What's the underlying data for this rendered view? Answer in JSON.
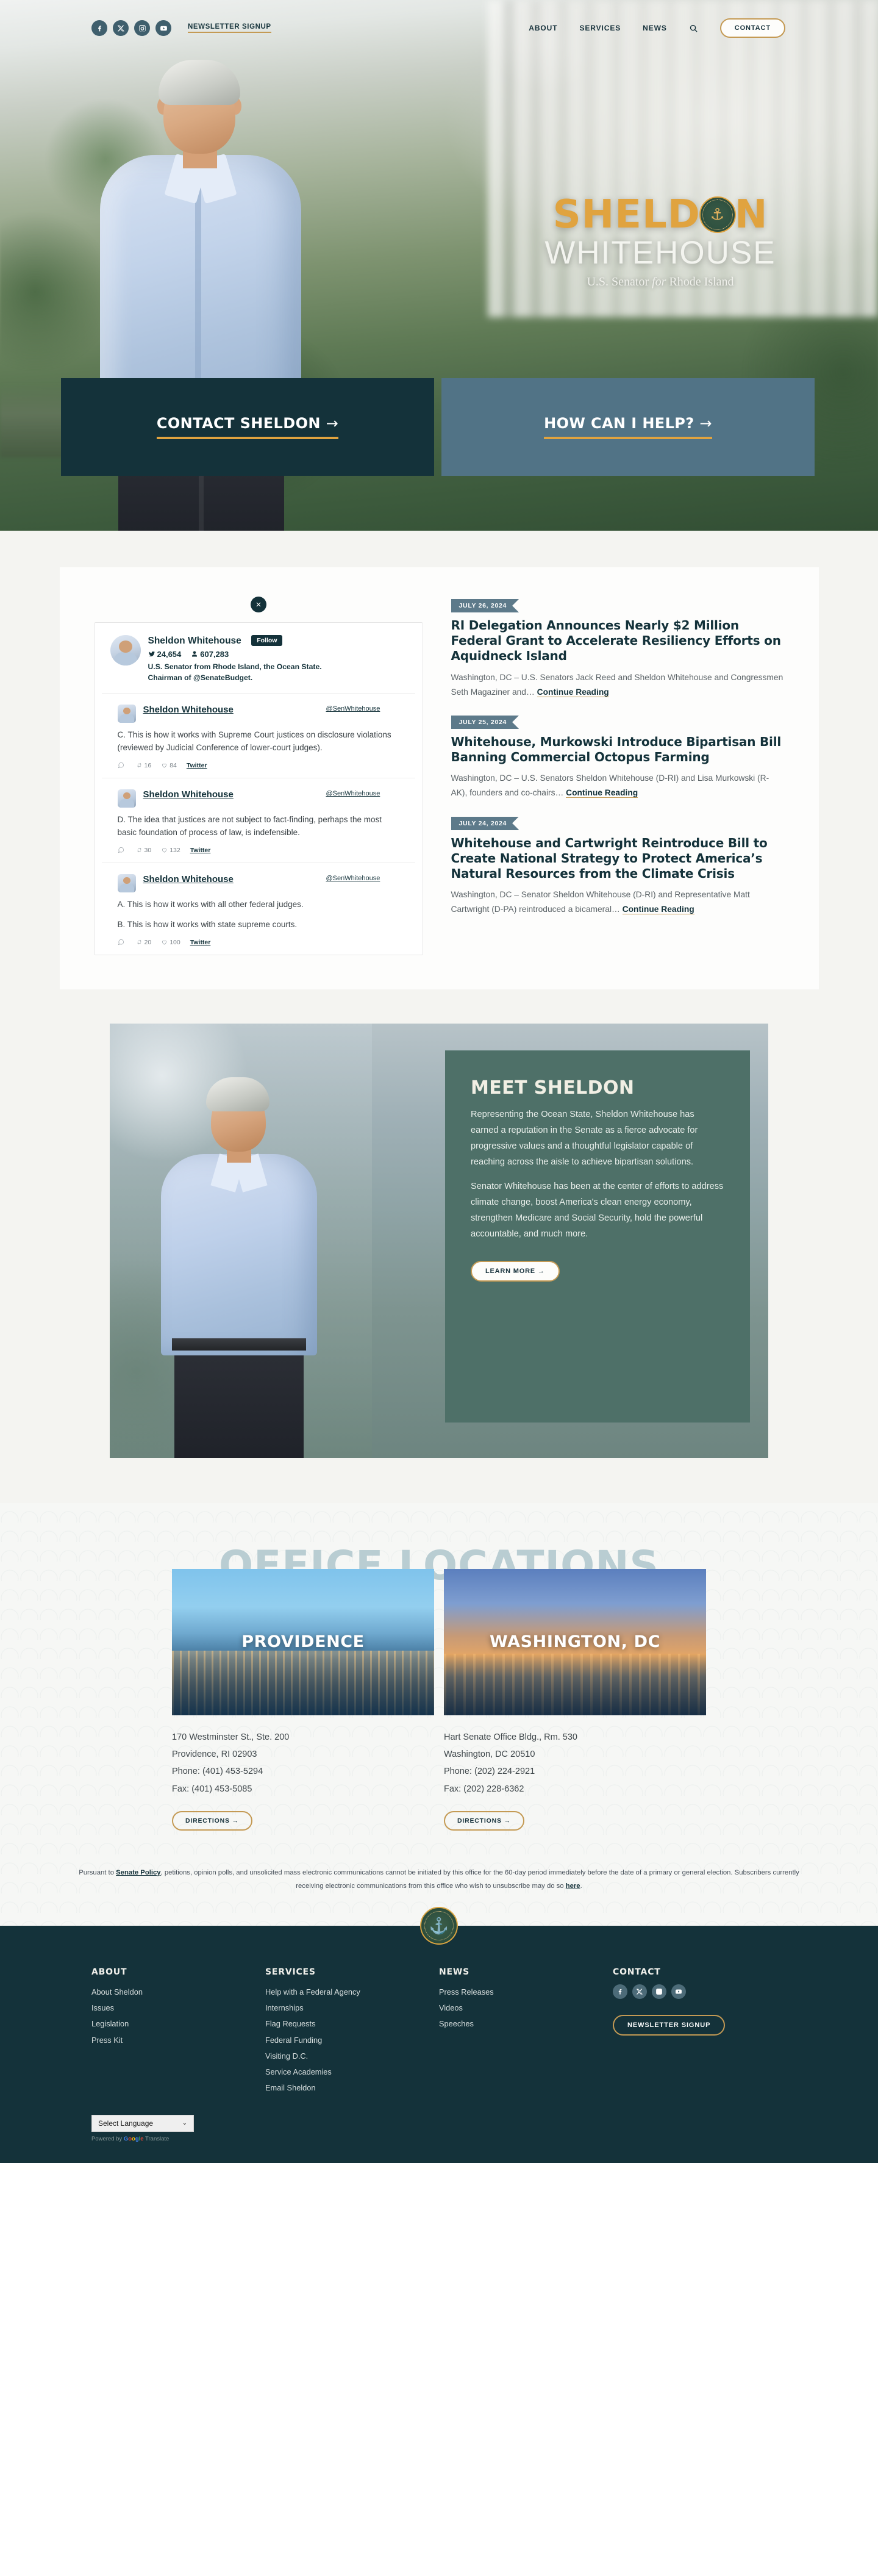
{
  "header": {
    "social": [
      {
        "name": "facebook",
        "glyph": "f"
      },
      {
        "name": "x-twitter",
        "glyph": "X"
      },
      {
        "name": "instagram",
        "glyph": "o"
      },
      {
        "name": "youtube",
        "glyph": "y"
      }
    ],
    "newsletter_label": "NEWSLETTER SIGNUP",
    "nav": [
      {
        "label": "ABOUT"
      },
      {
        "label": "SERVICES"
      },
      {
        "label": "NEWS"
      }
    ],
    "search_label": "Search",
    "contact_label": "CONTACT"
  },
  "hero": {
    "logo_first": "SHELD",
    "logo_last": "N",
    "logo_second_line": "WHITEHOUSE",
    "tagline_pre": "U.S. Senator ",
    "tagline_em": "for",
    "tagline_post": " Rhode Island",
    "cta_primary": "CONTACT SHELDON",
    "cta_primary_arrow": "→",
    "cta_secondary": "HOW CAN I HELP?",
    "cta_secondary_arrow": "→"
  },
  "twitter": {
    "close_label": "Close",
    "account_name": "Sheldon Whitehouse",
    "follow_label": "Follow",
    "tweet_count": "24,654",
    "follower_count": "607,283",
    "bio": "U.S. Senator from Rhode Island, the Ocean State. Chairman of @SenateBudget.",
    "tweets": [
      {
        "user": "Sheldon Whitehouse",
        "handle": "@SenWhitehouse",
        "lines": [
          "C.  This is how it works with Supreme Court justices on disclosure violations (reviewed by Judicial Conference of lower-court judges)."
        ],
        "replies": "",
        "retweets": "16",
        "likes": "84",
        "source": "Twitter"
      },
      {
        "user": "Sheldon Whitehouse",
        "handle": "@SenWhitehouse",
        "lines": [
          "D.  The idea that justices are not subject to fact-finding, perhaps the most basic foundation of process of law, is indefensible."
        ],
        "replies": "",
        "retweets": "30",
        "likes": "132",
        "source": "Twitter"
      },
      {
        "user": "Sheldon Whitehouse",
        "handle": "@SenWhitehouse",
        "lines": [
          "A.  This is how it works with all other federal judges.",
          "B.  This is how it works with state supreme courts."
        ],
        "replies": "",
        "retweets": "20",
        "likes": "100",
        "source": "Twitter"
      }
    ]
  },
  "news": {
    "continue_label": "Continue Reading",
    "items": [
      {
        "date": "JULY 26, 2024",
        "title": "RI Delegation Announces Nearly $2 Million Federal Grant to Accelerate Resiliency Efforts on Aquidneck Island",
        "excerpt": "Washington, DC – U.S. Senators Jack Reed and Sheldon Whitehouse and Congressmen Seth Magaziner and…"
      },
      {
        "date": "JULY 25, 2024",
        "title": "Whitehouse, Murkowski Introduce Bipartisan Bill Banning Commercial Octopus Farming",
        "excerpt": "Washington, DC – U.S. Senators Sheldon Whitehouse (D-RI) and Lisa Murkowski (R-AK), founders and co-chairs…"
      },
      {
        "date": "JULY 24, 2024",
        "title": "Whitehouse and Cartwright Reintroduce Bill to Create National Strategy to Protect America’s Natural Resources from the Climate Crisis",
        "excerpt": "Washington, DC – Senator Sheldon Whitehouse (D-RI) and Representative Matt Cartwright (D-PA) reintroduced a bicameral…"
      }
    ]
  },
  "meet": {
    "heading": "MEET SHELDON",
    "paragraph1": "Representing the Ocean State, Sheldon Whitehouse has earned a reputation in the Senate as a fierce advocate for progressive values and a thoughtful legislator capable of reaching across the aisle to achieve bipartisan solutions.",
    "paragraph2": "Senator Whitehouse has been at the center of efforts to address climate change, boost America's clean energy economy, strengthen Medicare and Social Security, hold the powerful accountable, and much more.",
    "button_label": "LEARN MORE →"
  },
  "offices": {
    "title": "OFFICE LOCATIONS",
    "directions_label": "DIRECTIONS →",
    "items": [
      {
        "name": "PROVIDENCE",
        "address1": "170 Westminster St., Ste. 200",
        "address2": "Providence, RI 02903",
        "phone": "Phone: (401) 453-5294",
        "fax": "Fax: (401) 453-5085"
      },
      {
        "name": "WASHINGTON, DC",
        "address1": "Hart Senate Office Bldg., Rm. 530",
        "address2": "Washington, DC 20510",
        "phone": "Phone: (202) 224-2921",
        "fax": "Fax: (202) 228-6362"
      }
    ],
    "disclaimer_pre": "Pursuant to ",
    "disclaimer_link1": "Senate Policy",
    "disclaimer_mid": ", petitions, opinion polls, and unsolicited mass electronic communications cannot be initiated by this office for the 60-day period immediately before the date of a primary or general election. Subscribers currently receiving electronic communications from this office who wish to unsubscribe may do so ",
    "disclaimer_link2": "here",
    "disclaimer_post": "."
  },
  "footer": {
    "columns": [
      {
        "heading": "ABOUT",
        "links": [
          "About Sheldon",
          "Issues",
          "Legislation",
          "Press Kit"
        ]
      },
      {
        "heading": "SERVICES",
        "links": [
          "Help with a Federal Agency",
          "Internships",
          "Flag Requests",
          "Federal Funding",
          "Visiting D.C.",
          "Service Academies",
          "Email Sheldon"
        ]
      },
      {
        "heading": "NEWS",
        "links": [
          "Press Releases",
          "Videos",
          "Speeches"
        ]
      }
    ],
    "contact_heading": "CONTACT",
    "social": [
      {
        "name": "facebook"
      },
      {
        "name": "x-twitter"
      },
      {
        "name": "instagram"
      },
      {
        "name": "youtube"
      }
    ],
    "newsletter_label": "NEWSLETTER SIGNUP",
    "language_label": "Select Language",
    "language_caret": "⌄",
    "powered_pre": "Powered by ",
    "powered_google": "Google",
    "powered_post": " Translate"
  },
  "colors": {
    "dark_teal": "#14323a",
    "slate_blue": "#517386",
    "gold": "#c49a54",
    "logo_gold": "#e0a33f",
    "meet_green": "#4e7068",
    "offices_title": "#b9cdd2"
  }
}
